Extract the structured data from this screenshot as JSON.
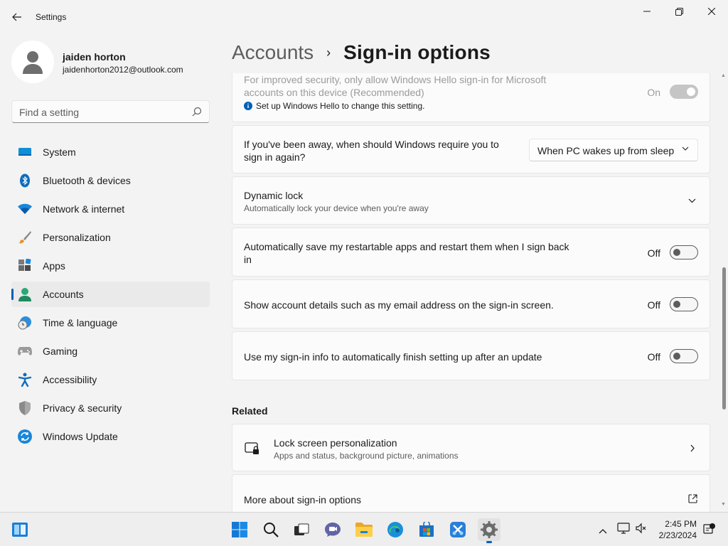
{
  "window": {
    "title": "Settings"
  },
  "profile": {
    "name": "jaiden horton",
    "email": "jaidenhorton2012@outlook.com"
  },
  "search": {
    "placeholder": "Find a setting"
  },
  "nav": {
    "items": [
      {
        "label": "System",
        "icon": "monitor-icon"
      },
      {
        "label": "Bluetooth & devices",
        "icon": "bluetooth-icon"
      },
      {
        "label": "Network & internet",
        "icon": "wifi-icon"
      },
      {
        "label": "Personalization",
        "icon": "paintbrush-icon"
      },
      {
        "label": "Apps",
        "icon": "apps-icon"
      },
      {
        "label": "Accounts",
        "icon": "person-icon",
        "active": true
      },
      {
        "label": "Time & language",
        "icon": "clock-globe-icon"
      },
      {
        "label": "Gaming",
        "icon": "gamepad-icon"
      },
      {
        "label": "Accessibility",
        "icon": "accessibility-icon"
      },
      {
        "label": "Privacy & security",
        "icon": "shield-icon"
      },
      {
        "label": "Windows Update",
        "icon": "update-icon"
      }
    ]
  },
  "breadcrumb": {
    "parent": "Accounts",
    "separator": "›",
    "current": "Sign-in options"
  },
  "settings": {
    "hello_only": {
      "line1": "For improved security, only allow Windows Hello sign-in for Microsoft",
      "line2": "accounts on this device (Recommended)",
      "info": "Set up Windows Hello to change this setting.",
      "state": "On"
    },
    "require_signin": {
      "line1": "If you've been away, when should Windows require you to",
      "line2": "sign in again?",
      "selected": "When PC wakes up from sleep"
    },
    "dynamic_lock": {
      "title": "Dynamic lock",
      "subtitle": "Automatically lock your device when you're away"
    },
    "restart_apps": {
      "line1": "Automatically save my restartable apps and restart them when I sign back",
      "line2": "in",
      "state": "Off"
    },
    "account_details": {
      "label": "Show account details such as my email address on the sign-in screen.",
      "state": "Off"
    },
    "signin_info": {
      "label": "Use my sign-in info to automatically finish setting up after an update",
      "state": "Off"
    }
  },
  "related": {
    "title": "Related",
    "lock_screen": {
      "title": "Lock screen personalization",
      "subtitle": "Apps and status, background picture, animations"
    },
    "more": {
      "title": "More about sign-in options"
    }
  },
  "taskbar": {
    "time": "2:45 PM",
    "date": "2/23/2024",
    "accent": "#005fb8"
  }
}
